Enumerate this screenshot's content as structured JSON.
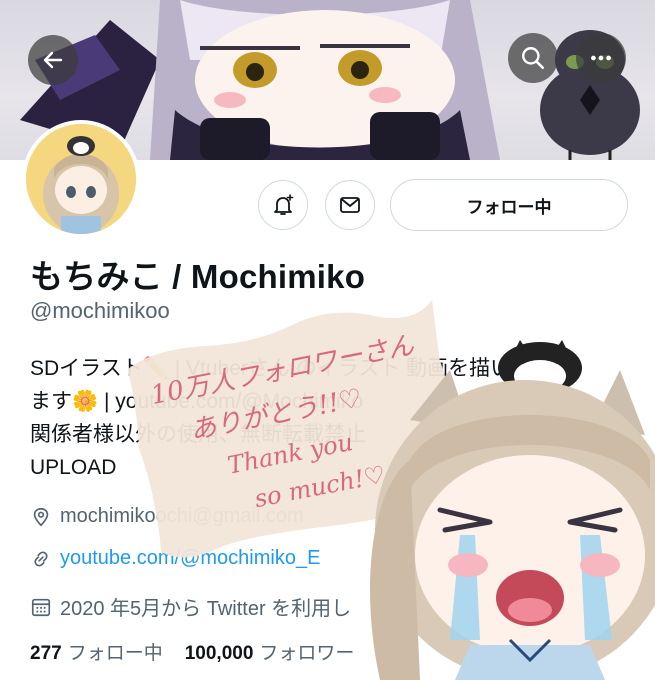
{
  "header": {
    "back_icon": "arrow-left-icon",
    "search_icon": "search-icon",
    "more_icon": "more-dots-icon"
  },
  "profile": {
    "display_name": "もちみこ / Mochimiko",
    "handle": "@mochimikoo",
    "follow_button_label": "フォロー中",
    "notify_icon": "bell-plus-icon",
    "message_icon": "envelope-icon",
    "bio_lines": [
      "SDイラスト✏️ | Vtuberさん のイラスト 動画を描いてい",
      "ます🌼 | youtube.com/@Mochimiko",
      "関係者様以外の使用、無断転載禁止",
      "UPLOAD"
    ],
    "bio_link": "youtube.com/@Mochimiko"
  },
  "meta": {
    "location": "mochimikoochi@gmail.com",
    "website": "youtube.com/@mochimiko_E",
    "joined": "2020 年5月から Twitter を利用し"
  },
  "stats": {
    "following_count": "277",
    "following_label": "フォロー中",
    "followers_count": "100,000",
    "followers_label": "フォロワー"
  },
  "overlay": {
    "line1": "10万人フォロワーさん",
    "line2": "ありがとう!!♡",
    "line3": "Thank you",
    "line4": "so much!♡"
  },
  "colors": {
    "link": "#1d9bf0",
    "muted": "#536471",
    "text": "#0f1419",
    "border": "#cfd9de",
    "note_ink": "#d7687e"
  }
}
